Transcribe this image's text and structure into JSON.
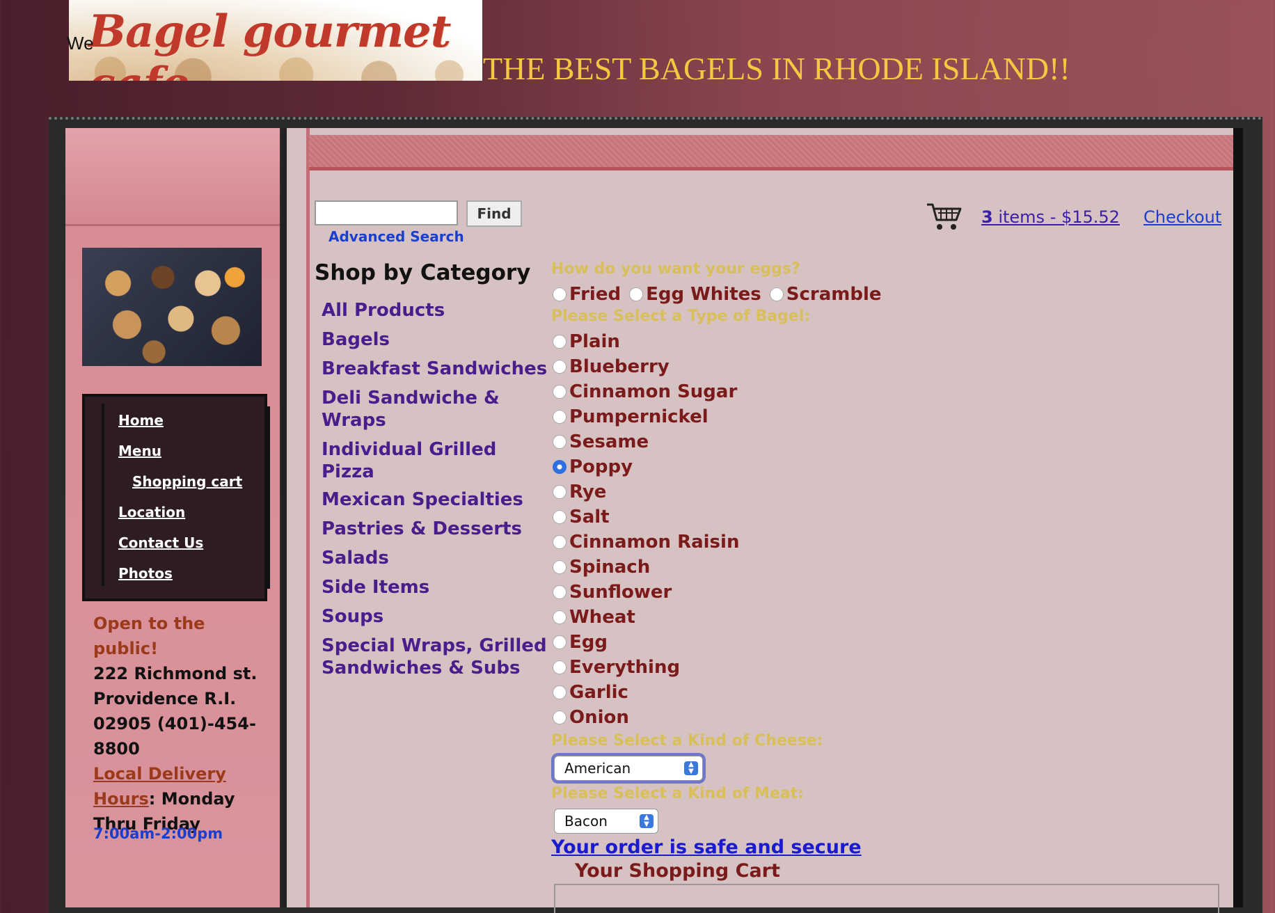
{
  "header": {
    "logo_text": "Bagel gourmet cafe",
    "we_text": "We",
    "tagline": "THE BEST BAGELS IN RHODE ISLAND!!"
  },
  "sidebar": {
    "nav": [
      {
        "label": "Home"
      },
      {
        "label": "Menu"
      },
      {
        "label": "Shopping cart"
      },
      {
        "label": "Location"
      },
      {
        "label": "Contact Us"
      },
      {
        "label": "Photos"
      }
    ],
    "open_text": "Open to the public!",
    "address": "222 Richmond st. Providence R.I. 02905 (401)-454-8800",
    "delivery_link": "Local Delivery Hours",
    "delivery_rest": ": Monday Thru Friday",
    "hours": "7:00am-2:00pm"
  },
  "search": {
    "find_label": "Find",
    "advanced_label": "Advanced Search",
    "value": ""
  },
  "cart": {
    "count": "3",
    "summary_rest": " items - $15.52",
    "checkout_label": "Checkout"
  },
  "categories": {
    "title": "Shop by Category",
    "items": [
      "All Products",
      "Bagels",
      "Breakfast Sandwiches",
      "Deli Sandwiche & Wraps",
      "Individual Grilled Pizza",
      "Mexican Specialties",
      "Pastries & Desserts",
      "Salads",
      "Side Items",
      "Soups",
      "Special Wraps, Grilled Sandwiches & Subs"
    ]
  },
  "options": {
    "eggs_label": "How do you want your eggs?",
    "eggs": [
      "Fried",
      "Egg Whites",
      "Scramble"
    ],
    "bagel_label": "Please Select a Type of Bagel:",
    "bagels": [
      "Plain",
      "Blueberry",
      "Cinnamon Sugar",
      "Pumpernickel",
      "Sesame",
      "Poppy",
      "Rye",
      "Salt",
      "Cinnamon Raisin",
      "Spinach",
      "Sunflower",
      "Wheat",
      "Egg",
      "Everything",
      "Garlic",
      "Onion"
    ],
    "bagel_selected": "Poppy",
    "cheese_label": "Please Select a Kind of Cheese:",
    "cheese_value": "American",
    "meat_label": "Please Select a Kind of Meat:",
    "meat_value": "Bacon"
  },
  "secure_link": "Your order is safe and secure",
  "cart_legend": "Your Shopping Cart",
  "colors": {
    "tagline": "#f5c842",
    "category_link": "#4a1d8c",
    "option_label": "#d9bf5a",
    "option_text": "#7a1a1a",
    "link_blue": "#1a3fd0"
  }
}
